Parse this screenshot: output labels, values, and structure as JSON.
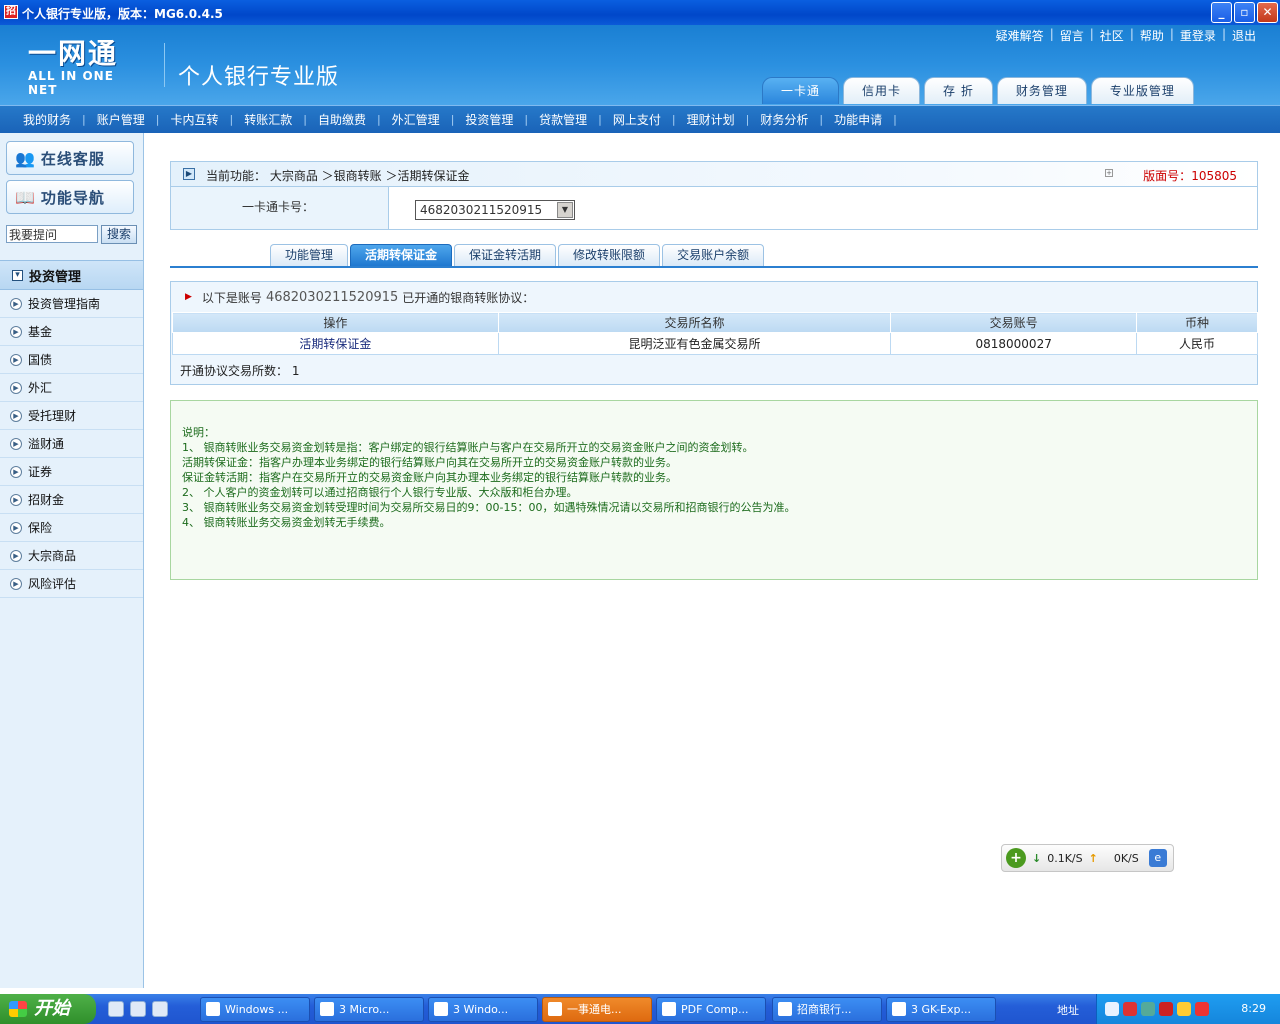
{
  "window": {
    "title": "个人银行专业版，版本：MG6.0.4.5",
    "min": "_",
    "max": "▫",
    "close": "✕"
  },
  "header": {
    "logo_main": "一网通",
    "logo_sub": "ALL IN ONE NET",
    "product": "个人银行专业版",
    "links": [
      "疑难解答",
      "留言",
      "社区",
      "帮助",
      "重登录",
      "退出"
    ],
    "tabs": [
      {
        "label": "一卡通",
        "active": true
      },
      {
        "label": "信用卡",
        "active": false
      },
      {
        "label": "存  折",
        "active": false
      },
      {
        "label": "财务管理",
        "active": false
      },
      {
        "label": "专业版管理",
        "active": false
      }
    ]
  },
  "menu": [
    "我的财务",
    "账户管理",
    "卡内互转",
    "转账汇款",
    "自助缴费",
    "外汇管理",
    "投资管理",
    "贷款管理",
    "网上支付",
    "理财计划",
    "财务分析",
    "功能申请"
  ],
  "sidebar": {
    "online_service": "在线客服",
    "func_nav": "功能导航",
    "search_value": "我要提问",
    "search_btn": "搜索",
    "section": "投资管理",
    "items": [
      "投资管理指南",
      "基金",
      "国债",
      "外汇",
      "受托理财",
      "溢财通",
      "证券",
      "招财金",
      "保险",
      "大宗商品",
      "风险评估"
    ]
  },
  "breadcrumb": {
    "text": "当前功能： 大宗商品 ＞银商转账 ＞活期转保证金",
    "version_label": "版面号：",
    "version_value": "105805"
  },
  "card": {
    "label": "一卡通卡号：",
    "value": "4682030211520915"
  },
  "subtabs": [
    {
      "label": "功能管理",
      "active": false
    },
    {
      "label": "活期转保证金",
      "active": true
    },
    {
      "label": "保证金转活期",
      "active": false
    },
    {
      "label": "修改转账限额",
      "active": false
    },
    {
      "label": "交易账户余额",
      "active": false
    }
  ],
  "agreements": {
    "intro_prefix": "以下是账号",
    "account": "4682030211520915",
    "intro_suffix": "已开通的银商转账协议：",
    "columns": [
      "操作",
      "交易所名称",
      "交易账号",
      "币种"
    ],
    "rows": [
      [
        "活期转保证金",
        "昆明泛亚有色金属交易所",
        "0818000027",
        "人民币"
      ]
    ],
    "count_label": "开通协议交易所数：",
    "count_value": "1"
  },
  "notes": [
    "说明：",
    "1、  银商转账业务交易资金划转是指：客户绑定的银行结算账户与客户在交易所开立的交易资金账户之间的资金划转。",
    "活期转保证金：指客户办理本业务绑定的银行结算账户向其在交易所开立的交易资金账户转款的业务。",
    "保证金转活期：指客户在交易所开立的交易资金账户向其办理本业务绑定的银行结算账户转款的业务。",
    "2、  个人客户的资金划转可以通过招商银行个人银行专业版、大众版和柜台办理。",
    "3、  银商转账业务交易资金划转受理时间为交易所交易日的9：00-15：00，如遇特殊情况请以交易所和招商银行的公告为准。",
    "4、  银商转账业务交易资金划转无手续费。"
  ],
  "speed": {
    "down": "0.1K/S",
    "up": "0K/S"
  },
  "taskbar": {
    "start": "开始",
    "tasks": [
      {
        "label": "Windows ...",
        "active": false
      },
      {
        "label": "3 Micro...",
        "active": false
      },
      {
        "label": "3 Windo...",
        "active": false
      },
      {
        "label": "一事通电...",
        "active": true
      },
      {
        "label": "PDF Comp...",
        "active": false
      },
      {
        "label": "招商银行...",
        "active": false
      },
      {
        "label": "3 GK-Exp...",
        "active": false
      }
    ],
    "address": "地址",
    "time": "8:29"
  }
}
